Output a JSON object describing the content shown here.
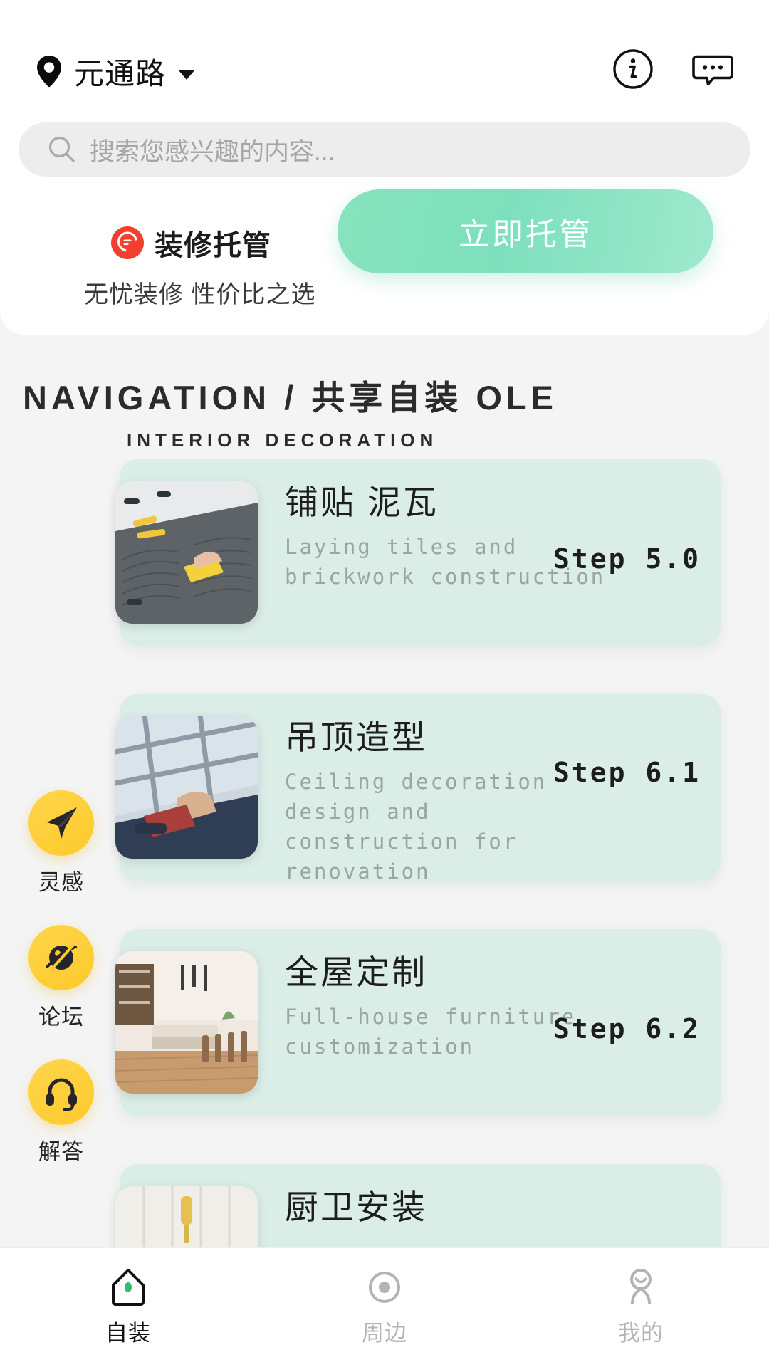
{
  "header": {
    "location_icon": "map-pin-icon",
    "location_name": "元通路",
    "dropdown_icon": "chevron-down-icon",
    "info_icon": "info-circle-icon",
    "message_icon": "chat-bubble-icon"
  },
  "search": {
    "icon": "search-icon",
    "placeholder": "搜索您感兴趣的内容..."
  },
  "promo": {
    "badge_icon": "decoration-badge-icon",
    "title": "装修托管",
    "subtitle": "无忧装修 性价比之选",
    "cta_label": "立即托管",
    "accent_color": "#7de0bd",
    "badge_color": "#f43f2e"
  },
  "navigation_section": {
    "title": "NAVIGATION / 共享自装 OLE",
    "subtitle": "INTERIOR DECORATION"
  },
  "cards": [
    {
      "title": "铺贴 泥瓦",
      "desc": "Laying tiles and brickwork construction",
      "step": "Step 5.0",
      "thumb": "tiling-photo"
    },
    {
      "title": "吊顶造型",
      "desc": "Ceiling decoration design and construction for renovation",
      "step": "Step 6.1",
      "thumb": "ceiling-photo"
    },
    {
      "title": "全屋定制",
      "desc": "Full-house furniture customization",
      "step": "Step 6.2",
      "thumb": "furniture-photo"
    },
    {
      "title": "厨卫安装",
      "desc": "",
      "step": "",
      "thumb": "kitchen-photo"
    }
  ],
  "side_rail": [
    {
      "label": "灵感",
      "icon": "paper-plane-icon"
    },
    {
      "label": "论坛",
      "icon": "planet-icon"
    },
    {
      "label": "解答",
      "icon": "headset-icon"
    }
  ],
  "bottom_nav": [
    {
      "label": "自装",
      "icon": "home-icon",
      "active": true
    },
    {
      "label": "周边",
      "icon": "nearby-icon",
      "active": false
    },
    {
      "label": "我的",
      "icon": "profile-icon",
      "active": false
    }
  ]
}
